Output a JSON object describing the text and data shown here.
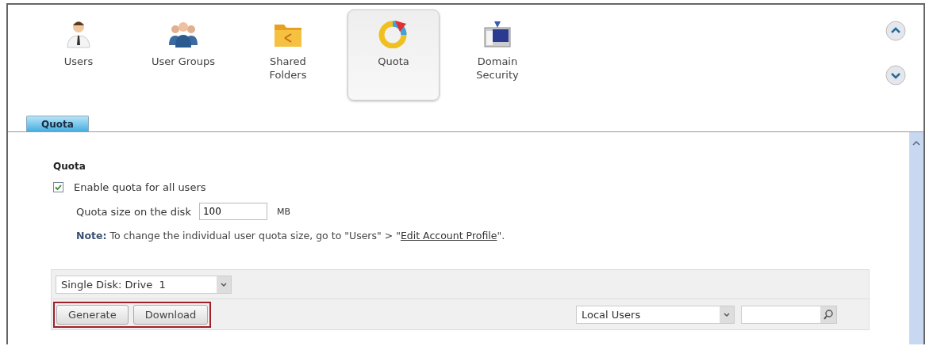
{
  "nav_items": [
    {
      "label": "Users",
      "kind": "user",
      "selected": false
    },
    {
      "label": "User Groups",
      "kind": "group",
      "selected": false
    },
    {
      "label": "Shared\nFolders",
      "kind": "folder",
      "selected": false
    },
    {
      "label": "Quota",
      "kind": "quota",
      "selected": true
    },
    {
      "label": "Domain\nSecurity",
      "kind": "domain",
      "selected": false
    }
  ],
  "tabs": [
    {
      "label": "Quota",
      "selected": true
    }
  ],
  "section_title": "Quota",
  "enable_quota": {
    "label": "Enable quota for all users",
    "checked": true
  },
  "quota_size": {
    "label": "Quota size on the disk",
    "value": "100",
    "unit": "MB"
  },
  "note": {
    "before": "**Note:** To change the individual user quota size, go to \"Users\" > \"",
    "link": "Edit Account Profile",
    "after": "\"."
  },
  "disk_select": {
    "value": "Single Disk: Drive  1"
  },
  "buttons": [
    "Generate",
    "Download"
  ],
  "user_type_select": {
    "value": "Local Users"
  }
}
